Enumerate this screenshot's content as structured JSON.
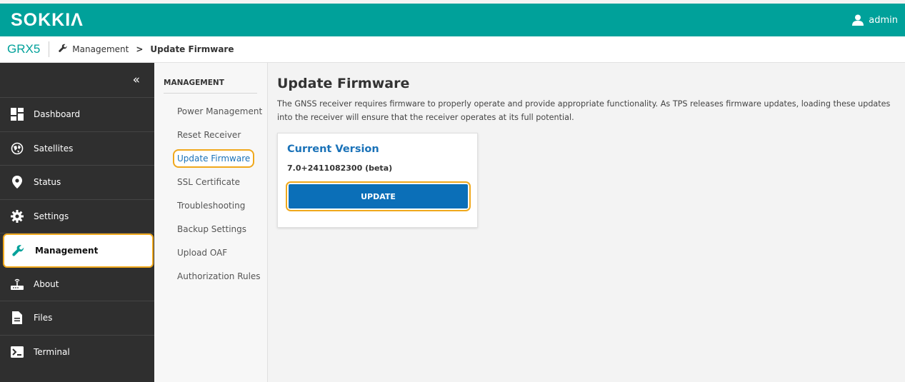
{
  "header": {
    "logo": "SOKKIΛ",
    "user_label": "admin"
  },
  "breadcrumb": {
    "device": "GRX5",
    "section": "Management",
    "separator": ">",
    "current": "Update Firmware"
  },
  "sidebar": {
    "collapse_label": "«",
    "items": [
      {
        "label": "Dashboard",
        "icon": "dashboard-icon"
      },
      {
        "label": "Satellites",
        "icon": "satellite-icon"
      },
      {
        "label": "Status",
        "icon": "map-pin-icon"
      },
      {
        "label": "Settings",
        "icon": "gear-icon"
      },
      {
        "label": "Management",
        "icon": "wrench-icon",
        "active": true
      },
      {
        "label": "About",
        "icon": "receiver-icon"
      },
      {
        "label": "Files",
        "icon": "file-icon"
      },
      {
        "label": "Terminal",
        "icon": "terminal-icon"
      }
    ]
  },
  "submenu": {
    "title": "MANAGEMENT",
    "items": [
      {
        "label": "Power Management"
      },
      {
        "label": "Reset Receiver"
      },
      {
        "label": "Update Firmware",
        "active": true
      },
      {
        "label": "SSL Certificate"
      },
      {
        "label": "Troubleshooting"
      },
      {
        "label": "Backup Settings"
      },
      {
        "label": "Upload OAF"
      },
      {
        "label": "Authorization Rules"
      }
    ]
  },
  "main": {
    "title": "Update Firmware",
    "description": "The GNSS receiver requires firmware to properly operate and provide appropriate functionality. As TPS releases firmware updates, loading these updates into the receiver will ensure that the receiver operates at its full potential.",
    "card": {
      "title": "Current Version",
      "version": "7.0+2411082300 (beta)",
      "button_label": "UPDATE"
    }
  },
  "colors": {
    "brand": "#00a19a",
    "sidebar_bg": "#2f2f2f",
    "highlight": "#f0a81c",
    "accent": "#1a72b8",
    "button": "#0b6fb8"
  }
}
